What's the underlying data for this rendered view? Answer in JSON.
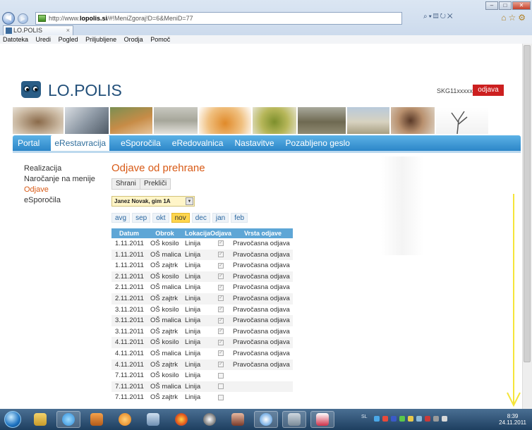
{
  "browser": {
    "url_prefix": "http://www.",
    "url_domain": "lopolis.si",
    "url_rest": "/#!MeniZgoraj!D=6&MeniD=77",
    "tab_title": "LO.POLIS",
    "menus": [
      "Datoteka",
      "Uredi",
      "Pogled",
      "Priljubljene",
      "Orodja",
      "Pomoč"
    ]
  },
  "header": {
    "logo_text": "LO.POLIS",
    "user_code": "SKG11xxxxxxx",
    "logout_label": "odjava"
  },
  "nav": {
    "items": [
      "Portal",
      "eRestavracija",
      "eSporočila",
      "eRedovalnica",
      "Nastavitve",
      "Pozabljeno geslo"
    ],
    "active": "eRestavracija"
  },
  "sidebar": {
    "items": [
      "Realizacija",
      "Naročanje na menije",
      "Odjave",
      "eSporočila"
    ],
    "active": "Odjave"
  },
  "main": {
    "title": "Odjave od prehrane",
    "save_label": "Shrani",
    "cancel_label": "Prekliči",
    "student_select": "Janez Novak, gim 1A",
    "months": [
      "avg",
      "sep",
      "okt",
      "nov",
      "dec",
      "jan",
      "feb"
    ],
    "active_month": "nov",
    "table": {
      "headers": [
        "Datum",
        "Obrok",
        "Lokacija",
        "Odjava",
        "Vrsta odjave"
      ],
      "rows": [
        {
          "date": "1.11.2011",
          "meal": "OŠ kosilo",
          "location": "Linija",
          "checked": true,
          "type": "Pravočasna odjava"
        },
        {
          "date": "1.11.2011",
          "meal": "OŠ malica",
          "location": "Linija",
          "checked": true,
          "type": "Pravočasna odjava"
        },
        {
          "date": "1.11.2011",
          "meal": "OŠ zajtrk",
          "location": "Linija",
          "checked": true,
          "type": "Pravočasna odjava"
        },
        {
          "date": "2.11.2011",
          "meal": "OŠ kosilo",
          "location": "Linija",
          "checked": true,
          "type": "Pravočasna odjava"
        },
        {
          "date": "2.11.2011",
          "meal": "OŠ malica",
          "location": "Linija",
          "checked": true,
          "type": "Pravočasna odjava"
        },
        {
          "date": "2.11.2011",
          "meal": "OŠ zajtrk",
          "location": "Linija",
          "checked": true,
          "type": "Pravočasna odjava"
        },
        {
          "date": "3.11.2011",
          "meal": "OŠ kosilo",
          "location": "Linija",
          "checked": true,
          "type": "Pravočasna odjava"
        },
        {
          "date": "3.11.2011",
          "meal": "OŠ malica",
          "location": "Linija",
          "checked": true,
          "type": "Pravočasna odjava"
        },
        {
          "date": "3.11.2011",
          "meal": "OŠ zajtrk",
          "location": "Linija",
          "checked": true,
          "type": "Pravočasna odjava"
        },
        {
          "date": "4.11.2011",
          "meal": "OŠ kosilo",
          "location": "Linija",
          "checked": true,
          "type": "Pravočasna odjava"
        },
        {
          "date": "4.11.2011",
          "meal": "OŠ malica",
          "location": "Linija",
          "checked": true,
          "type": "Pravočasna odjava"
        },
        {
          "date": "4.11.2011",
          "meal": "OŠ zajtrk",
          "location": "Linija",
          "checked": true,
          "type": "Pravočasna odjava"
        },
        {
          "date": "7.11.2011",
          "meal": "OŠ kosilo",
          "location": "Linija",
          "checked": false,
          "type": ""
        },
        {
          "date": "7.11.2011",
          "meal": "OŠ malica",
          "location": "Linija",
          "checked": false,
          "type": ""
        },
        {
          "date": "7.11.2011",
          "meal": "OŠ zajtrk",
          "location": "Linija",
          "checked": false,
          "type": ""
        }
      ]
    }
  },
  "taskbar": {
    "lang": "SL",
    "time": "8:39",
    "date": "24.11.2011"
  },
  "colors": {
    "accent_orange": "#d85a16",
    "nav_blue": "#2c86c8",
    "logout_red": "#cc1f1f",
    "month_highlight": "#ffd64d",
    "annotation_arrow": "#f5e53a"
  }
}
